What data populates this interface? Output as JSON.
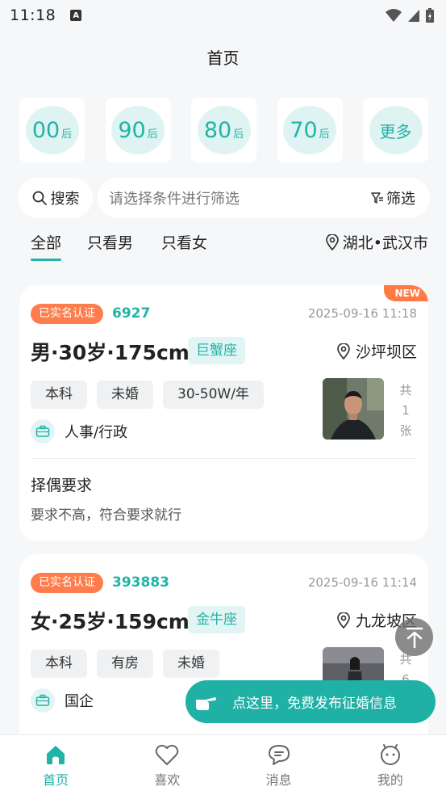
{
  "status_bar": {
    "time": "11:18",
    "notification_letter": "A"
  },
  "header": {
    "title": "首页"
  },
  "age_filters": [
    {
      "num": "00",
      "suffix": "后"
    },
    {
      "num": "90",
      "suffix": "后"
    },
    {
      "num": "80",
      "suffix": "后"
    },
    {
      "num": "70",
      "suffix": "后"
    },
    {
      "label": "更多"
    }
  ],
  "search": {
    "label": "搜索",
    "placeholder": "请选择条件进行筛选",
    "filter_label": "筛选"
  },
  "tabs": [
    {
      "label": "全部",
      "active": true
    },
    {
      "label": "只看男"
    },
    {
      "label": "只看女"
    }
  ],
  "location": "湖北•武汉市",
  "cards": [
    {
      "new_badge": "NEW",
      "verified": "已实名认证",
      "id": "6927",
      "date": "2025-09-16 11:18",
      "headline": "男·30岁·175cm",
      "zodiac": "巨蟹座",
      "district": "沙坪坝区",
      "tags": [
        "本科",
        "未婚",
        "30-50W/年"
      ],
      "job": "人事/行政",
      "photo_count": [
        "共",
        "1",
        "张"
      ],
      "requirement_title": "择偶要求",
      "requirement_text": "要求不高，符合要求就行"
    },
    {
      "verified": "已实名认证",
      "id": "393883",
      "date": "2025-09-16 11:14",
      "headline": "女·25岁·159cm",
      "zodiac": "金牛座",
      "district": "九龙坡区",
      "tags": [
        "本科",
        "有房",
        "未婚"
      ],
      "job": "国企",
      "photo_count": [
        "共",
        "6"
      ]
    }
  ],
  "publish_banner": "点这里，免费发布征婚信息",
  "bottom_nav": [
    {
      "label": "首页",
      "icon": "home-icon",
      "active": true
    },
    {
      "label": "喜欢",
      "icon": "heart-icon"
    },
    {
      "label": "消息",
      "icon": "message-icon"
    },
    {
      "label": "我的",
      "icon": "profile-icon"
    }
  ],
  "colors": {
    "accent": "#22b3a8",
    "verified": "#ff7d4d",
    "new_badge": "#ff7a45"
  }
}
